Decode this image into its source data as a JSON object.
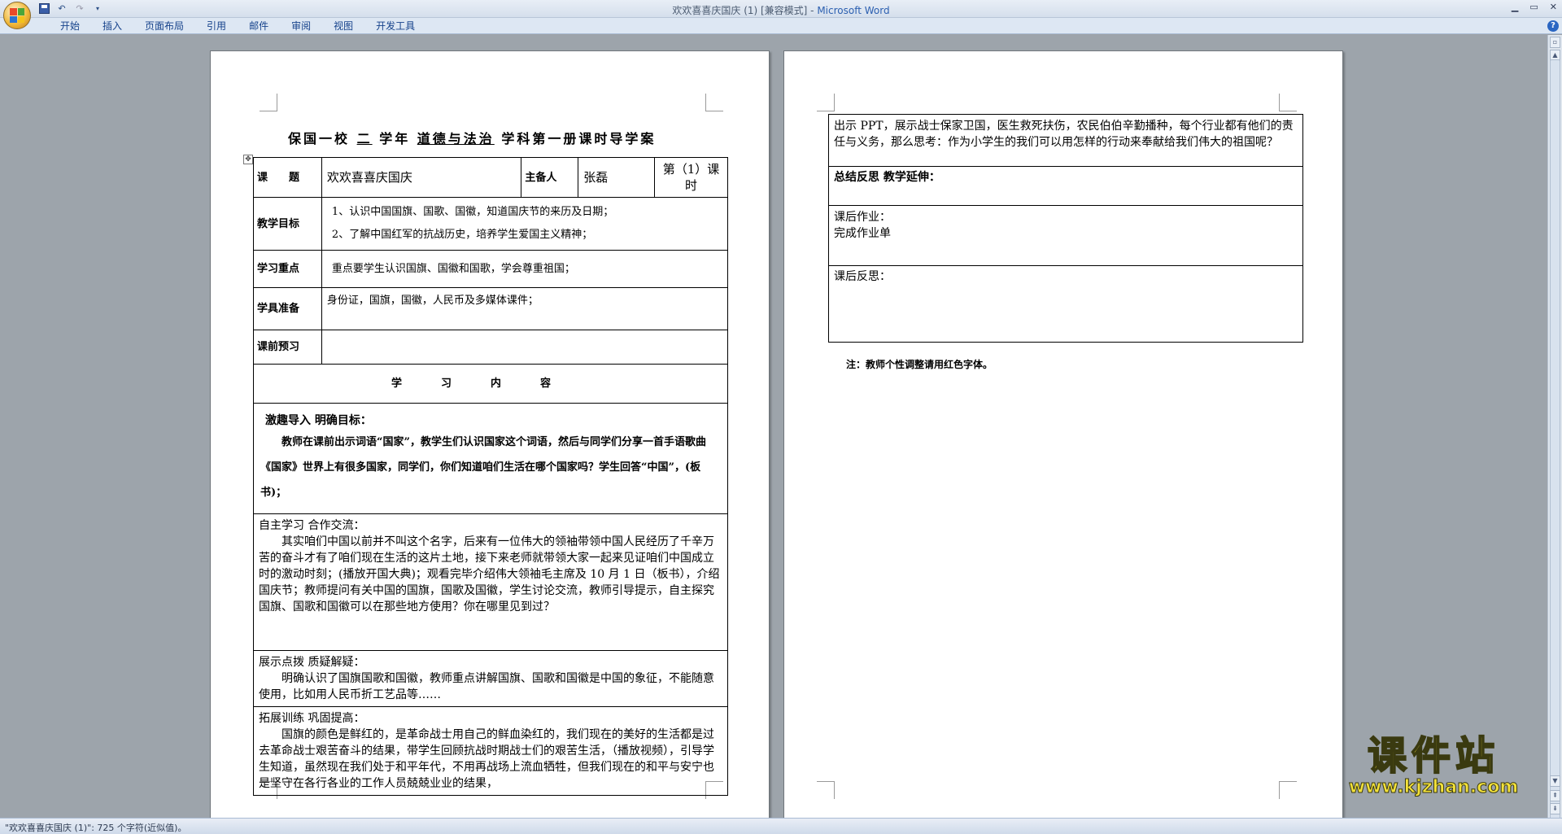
{
  "window": {
    "title_doc": "欢欢喜喜庆国庆 (1) [兼容模式] - ",
    "title_app": "Microsoft Word"
  },
  "ribbon": {
    "tabs": [
      "开始",
      "插入",
      "页面布局",
      "引用",
      "邮件",
      "审阅",
      "视图",
      "开发工具"
    ]
  },
  "page1": {
    "title_parts": [
      "保国一校",
      "二",
      "学年",
      "道德与法治",
      "学科第一册课时导学案"
    ],
    "rows": {
      "topic_label": "课　　题",
      "topic_value": "欢欢喜喜庆国庆",
      "preparer_label": "主备人",
      "preparer_value": "张磊",
      "period": "第（1）课时",
      "goals_label": "教学目标",
      "goals": [
        "1、认识中国国旗、国歌、国徽，知道国庆节的来历及日期；",
        "2、了解中国红军的抗战历史，培养学生爱国主义精神；"
      ],
      "key_label": "学习重点",
      "key_value": "重点要学生认识国旗、国徽和国歌，学会尊重祖国；",
      "prep_label": "学具准备",
      "prep_value": "身份证，国旗，国徽，人民币及多媒体课件；",
      "preview_label": "课前预习",
      "content_head": "学习内容",
      "s1_title": "激趣导入 明确目标：",
      "s1_body": "教师在课前出示词语“国家”，教学生们认识国家这个词语，然后与同学们分享一首手语歌曲《国家》世界上有很多国家，同学们，你们知道咱们生活在哪个国家吗？学生回答“中国”，(板书)；",
      "s2_title": "自主学习 合作交流：",
      "s2_body": "其实咱们中国以前并不叫这个名字，后来有一位伟大的领袖带领中国人民经历了千辛万苦的奋斗才有了咱们现在生活的这片土地，接下来老师就带领大家一起来见证咱们中国成立时的激动时刻；(播放开国大典)；观看完毕介绍伟大领袖毛主席及 10 月 1 日（板书），介绍国庆节；教师提问有关中国的国旗，国歌及国徽，学生讨论交流，教师引导提示，自主探究国旗、国歌和国徽可以在那些地方使用？你在哪里见到过？",
      "s3_title": "展示点拨 质疑解疑：",
      "s3_body": "明确认识了国旗国歌和国徽，教师重点讲解国旗、国歌和国徽是中国的象征，不能随意使用，比如用人民币折工艺品等……",
      "s4_title": "拓展训练 巩固提高：",
      "s4_body": "国旗的颜色是鲜红的，是革命战士用自己的鲜血染红的，我们现在的美好的生活都是过去革命战士艰苦奋斗的结果，带学生回顾抗战时期战士们的艰苦生活，（播放视频），引导学生知道，虽然现在我们处于和平年代，不用再战场上流血牺牲，但我们现在的和平与安宁也是坚守在各行各业的工作人员兢兢业业的结果，"
    }
  },
  "page2": {
    "cont_body": "出示 PPT，展示战士保家卫国，医生救死扶伤，农民伯伯辛勤播种，每个行业都有他们的责任与义务，那么思考：作为小学生的我们可以用怎样的行动来奉献给我们伟大的祖国呢？",
    "summary": "总结反思 教学延伸：",
    "homework_title": "课后作业：",
    "homework_body": "完成作业单",
    "reflection": "课后反思：",
    "note": "注：教师个性调整请用红色字体。"
  },
  "statusbar": {
    "text": "\"欢欢喜喜庆国庆 (1)\": 725 个字符(近似值)。"
  },
  "watermark": {
    "main": "课件站",
    "sub": "www.kjzhan.com"
  },
  "colors": {
    "ribbon_text": "#15428b",
    "app_blue": "#2b5fb0",
    "watermark_yellow": "#f4e23a"
  }
}
